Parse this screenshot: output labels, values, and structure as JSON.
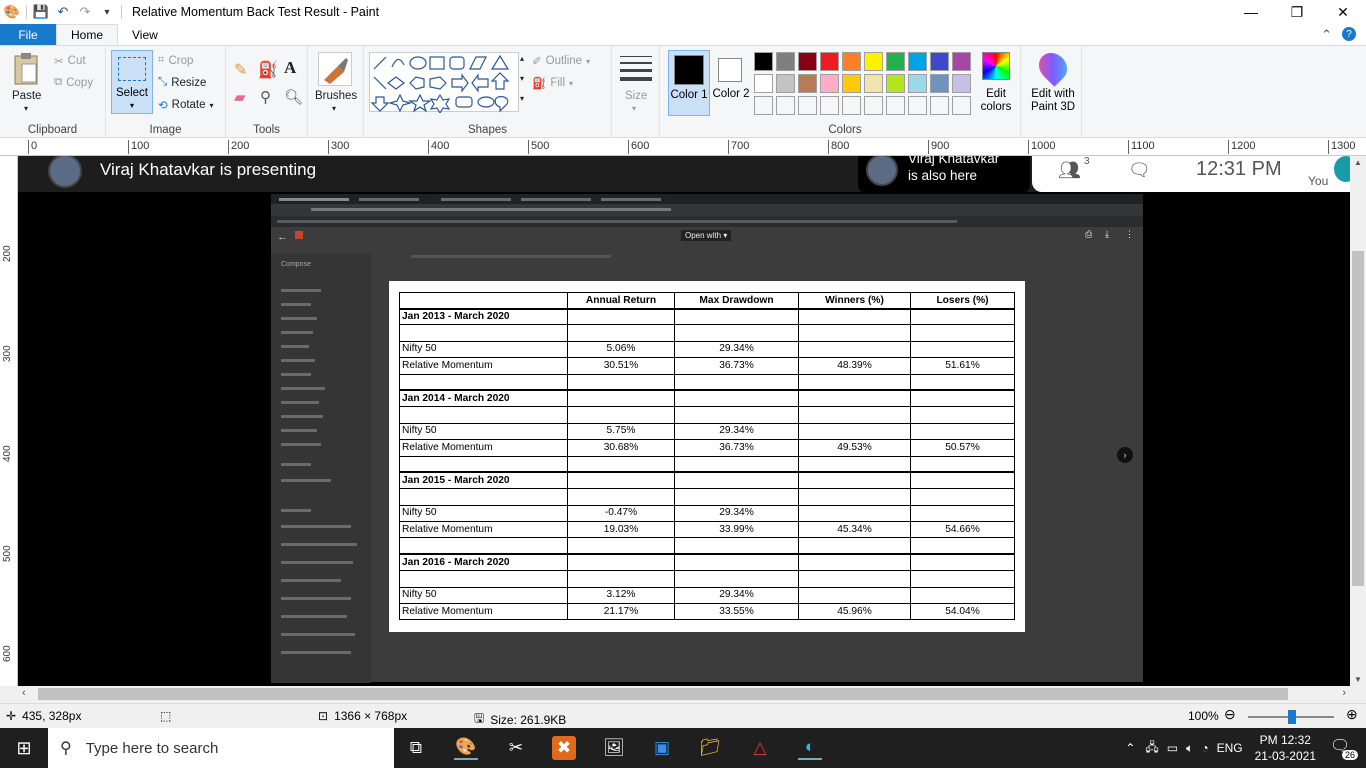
{
  "window": {
    "title": "Relative Momentum Back Test Result - Paint",
    "controls": {
      "minimize": "—",
      "restore": "❐",
      "close": "✕"
    }
  },
  "ribbon_tabs": [
    "File",
    "Home",
    "View"
  ],
  "ribbon": {
    "clipboard": {
      "paste": "Paste",
      "cut": "Cut",
      "copy": "Copy",
      "label": "Clipboard"
    },
    "image": {
      "select": "Select",
      "crop": "Crop",
      "resize": "Resize",
      "rotate": "Rotate",
      "label": "Image"
    },
    "tools": {
      "label": "Tools"
    },
    "brushes": {
      "label": "Brushes"
    },
    "shapes": {
      "outline": "Outline",
      "fill": "Fill",
      "label": "Shapes"
    },
    "size": {
      "label": "Size"
    },
    "colors": {
      "color1": "Color 1",
      "color2": "Color 2",
      "edit": "Edit colors",
      "paint3d": "Edit with Paint 3D",
      "label": "Colors",
      "palette": [
        "#000000",
        "#7f7f7f",
        "#880015",
        "#ed1c24",
        "#ff7f27",
        "#fff200",
        "#22b14c",
        "#00a2e8",
        "#3f48cc",
        "#a349a4",
        "#ffffff",
        "#c3c3c3",
        "#b97a57",
        "#ffaec9",
        "#ffc90e",
        "#efe4b0",
        "#b5e61d",
        "#99d9ea",
        "#7092be",
        "#c8bfe7"
      ]
    }
  },
  "ruler": {
    "marks": [
      "0",
      "100",
      "200",
      "300",
      "400",
      "500",
      "600",
      "700",
      "800",
      "900",
      "1000",
      "1100",
      "1200",
      "1300"
    ]
  },
  "vruler": {
    "marks": [
      "200",
      "300",
      "400",
      "500",
      "600"
    ]
  },
  "meet": {
    "presenting": "Viraj Khatavkar is presenting",
    "also_here_name": "Viraj Khatavkar",
    "also_here_text": "is also here",
    "participants_count": "3",
    "clock": "12:31 PM",
    "you": "You"
  },
  "gmail": {
    "open_with": "Open with",
    "compose": "Compose"
  },
  "table": {
    "headers": [
      "",
      "Annual Return",
      "Max Drawdown",
      "Winners (%)",
      "Losers (%)"
    ],
    "sections": [
      {
        "period": "Jan 2013 - March 2020",
        "nifty": [
          "Nifty 50",
          "5.06%",
          "29.34%",
          "",
          ""
        ],
        "rm": [
          "Relative Momentum",
          "30.51%",
          "36.73%",
          "48.39%",
          "51.61%"
        ]
      },
      {
        "period": "Jan 2014 - March 2020",
        "nifty": [
          "Nifty 50",
          "5.75%",
          "29.34%",
          "",
          ""
        ],
        "rm": [
          "Relative Momentum",
          "30.68%",
          "36.73%",
          "49.53%",
          "50.57%"
        ]
      },
      {
        "period": "Jan 2015 - March 2020",
        "nifty": [
          "Nifty 50",
          "-0.47%",
          "29.34%",
          "",
          ""
        ],
        "rm": [
          "Relative Momentum",
          "19.03%",
          "33.99%",
          "45.34%",
          "54.66%"
        ]
      },
      {
        "period": "Jan 2016 - March 2020",
        "nifty": [
          "Nifty 50",
          "3.12%",
          "29.34%",
          "",
          ""
        ],
        "rm": [
          "Relative Momentum",
          "21.17%",
          "33.55%",
          "45.96%",
          "54.04%"
        ]
      }
    ]
  },
  "status": {
    "cursor_pos": "435, 328px",
    "selection": "",
    "dimensions": "1366 × 768px",
    "size": "Size: 261.9KB",
    "zoom": "100%"
  },
  "taskbar": {
    "search_placeholder": "Type here to search",
    "language": "ENG",
    "time": "PM 12:32",
    "date": "21-03-2021",
    "notifications": "26"
  }
}
